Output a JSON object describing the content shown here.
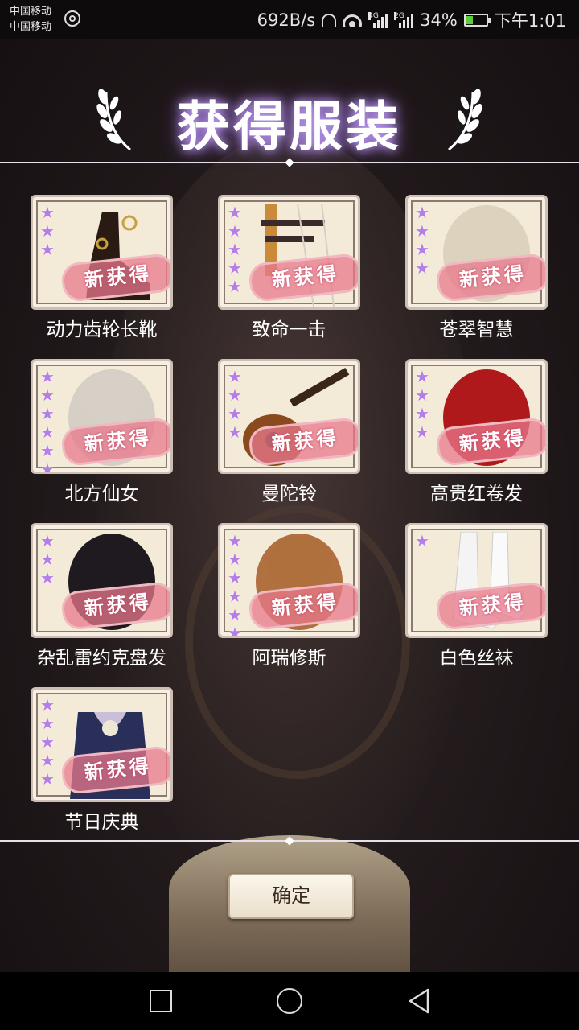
{
  "status_bar": {
    "carrier_1": "中国移动",
    "carrier_2": "中国移动",
    "speed": "692B/s",
    "net_4g": "4G",
    "net_2g": "2G",
    "battery": "34%",
    "time": "下午1:01",
    "battery_level": 0.34
  },
  "dialog": {
    "title": "获得服装",
    "stamp_label": "新获得",
    "confirm_label": "确定"
  },
  "items": [
    {
      "name": "动力齿轮长靴",
      "stars": 3,
      "icon": "boots-icon"
    },
    {
      "name": "致命一击",
      "stars": 5,
      "icon": "weapon-icon"
    },
    {
      "name": "苍翠智慧",
      "stars": 4,
      "icon": "hair-icon"
    },
    {
      "name": "北方仙女",
      "stars": 6,
      "icon": "hair-icon"
    },
    {
      "name": "曼陀铃",
      "stars": 4,
      "icon": "mandolin-icon"
    },
    {
      "name": "高贵红卷发",
      "stars": 4,
      "icon": "hair-icon"
    },
    {
      "name": "杂乱雷约克盘发",
      "stars": 3,
      "icon": "hair-icon"
    },
    {
      "name": "阿瑞修斯",
      "stars": 6,
      "icon": "hair-icon"
    },
    {
      "name": "白色丝袜",
      "stars": 1,
      "icon": "stockings-icon"
    },
    {
      "name": "节日庆典",
      "stars": 5,
      "icon": "outfit-icon"
    }
  ]
}
